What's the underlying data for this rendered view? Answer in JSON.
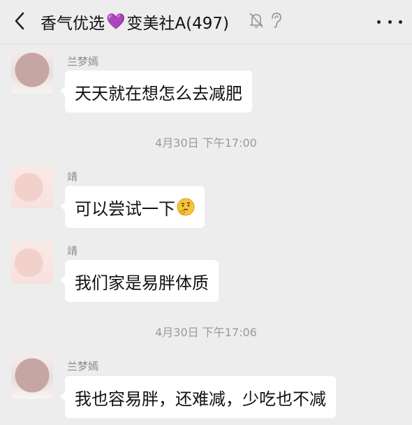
{
  "header": {
    "title_left": "香气优选",
    "title_heart": "💜",
    "title_right": "变美社A(497)",
    "icons": [
      "back-arrow-icon",
      "mute-bell-icon",
      "ear-icon",
      "more-icon"
    ]
  },
  "messages": [
    {
      "sender": "兰梦嫣",
      "text": "天天就在想怎么去减肥"
    },
    {
      "timestamp": "4月30日 下午17:00"
    },
    {
      "sender": "靖",
      "text": "可以尝试一下",
      "emoji": "thinking-face-icon"
    },
    {
      "sender": "靖",
      "text": "我们家是易胖体质"
    },
    {
      "timestamp": "4月30日 下午17:06"
    },
    {
      "sender": "兰梦嫣",
      "text": "我也容易胖，还难减，少吃也不减"
    }
  ],
  "colors": {
    "background": "#ededed",
    "bubble": "#ffffff",
    "meta_text": "#9a9a9a"
  }
}
